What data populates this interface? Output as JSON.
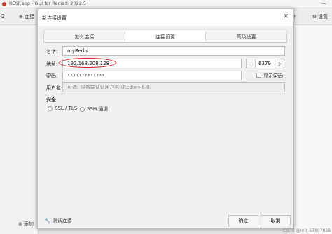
{
  "app": {
    "title": "RESP.app - GUI for Redis® 2022.5",
    "toolbar_number": "2",
    "connect_button_label": "连接",
    "right_partial_text": "er",
    "settings_button_label": "设置",
    "add_button_label": "添加",
    "minimize_glyph": "—"
  },
  "dialog": {
    "title": "新连接设置",
    "close_glyph": "✕",
    "tabs": [
      {
        "label": "怎么连接",
        "active": false
      },
      {
        "label": "连接设置",
        "active": true
      },
      {
        "label": "高级设置",
        "active": false
      }
    ],
    "form": {
      "name_label": "名字:",
      "name_value": "myRedis",
      "address_label": "地址:",
      "address_value": "192.168.208.128",
      "port_decrement": "−",
      "port_value": "6379",
      "port_increment": "+",
      "password_label": "密码:",
      "password_value": "•••••••••••••",
      "show_password_label": "显示密码",
      "username_label": "用户名:",
      "username_placeholder": "可选: 服务端认证用户名 (Redis >6.0)"
    },
    "security": {
      "heading": "安全",
      "options": [
        "SSL / TLS",
        "SSH 通道"
      ]
    },
    "footer": {
      "test_label": "测试连接",
      "ok_label": "确定",
      "cancel_label": "取消"
    }
  },
  "watermark": "CSDN @m0_57807838",
  "colors": {
    "highlight": "#d61f1f",
    "logo": "#c0392b"
  }
}
